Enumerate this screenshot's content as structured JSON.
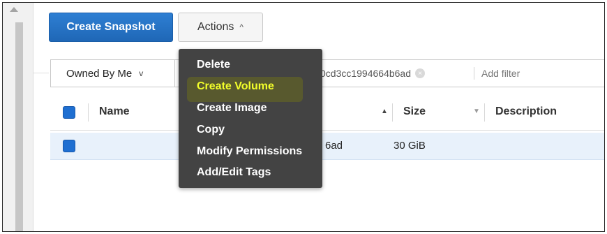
{
  "toolbar": {
    "create_snapshot_label": "Create Snapshot",
    "actions_label": "Actions",
    "actions_caret": "^"
  },
  "filter": {
    "owned_select_value": "Owned By Me",
    "owned_chevron": "v",
    "token_text": "0cd3cc1994664b6ad",
    "token_remove": "×",
    "add_filter_placeholder": "Add filter"
  },
  "table": {
    "columns": [
      "Name",
      "Size",
      "Description"
    ],
    "sort_asc": "▲",
    "sort_desc": "▼",
    "rows": [
      {
        "id_fragment": "6ad",
        "size": "30 GiB"
      }
    ]
  },
  "actions_menu": {
    "items": [
      "Delete",
      "Create Volume",
      "Create Image",
      "Copy",
      "Modify Permissions",
      "Add/Edit Tags"
    ],
    "highlighted_index": 1
  },
  "colors": {
    "primary_button": "#1f67b6",
    "checkbox": "#1f6fd1",
    "menu_bg": "#434343",
    "highlight_text": "#f3ff2a",
    "selected_row": "#e8f1fb"
  }
}
